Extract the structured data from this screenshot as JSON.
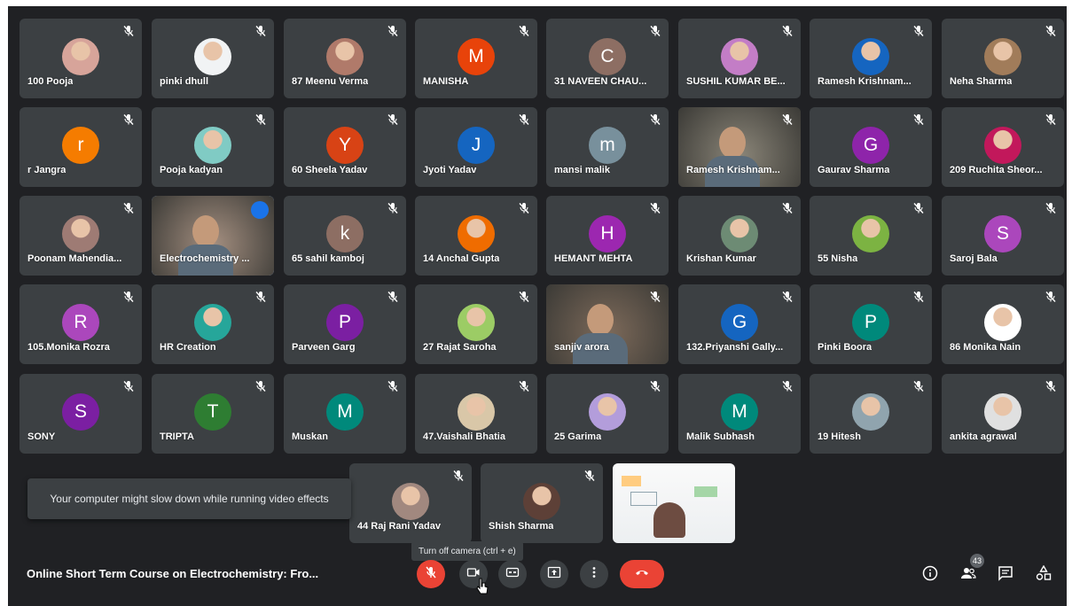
{
  "app": "Google Meet",
  "participants": [
    {
      "name": "100 Pooja",
      "avatar": "photo",
      "color": "#d7a49a"
    },
    {
      "name": "pinki dhull",
      "avatar": "photo",
      "color": "#f1f3f4"
    },
    {
      "name": "87 Meenu Verma",
      "avatar": "photo",
      "color": "#b07a6a"
    },
    {
      "name": "MANISHA",
      "avatar": "letter",
      "letter": "M",
      "color": "#e8430a"
    },
    {
      "name": "31 NAVEEN CHAU...",
      "avatar": "letter",
      "letter": "C",
      "color": "#8d6e63"
    },
    {
      "name": "SUSHIL KUMAR BE...",
      "avatar": "photo",
      "color": "#c37dc6"
    },
    {
      "name": "Ramesh Krishnam...",
      "avatar": "photo",
      "color": "#1565c0"
    },
    {
      "name": "Neha Sharma",
      "avatar": "photo",
      "color": "#a17c5a"
    },
    {
      "name": "r Jangra",
      "avatar": "letter",
      "letter": "r",
      "color": "#f57c00"
    },
    {
      "name": "Pooja kadyan",
      "avatar": "photo",
      "color": "#80cbc4"
    },
    {
      "name": "60 Sheela Yadav",
      "avatar": "letter",
      "letter": "Y",
      "color": "#d84315"
    },
    {
      "name": "Jyoti Yadav",
      "avatar": "letter",
      "letter": "J",
      "color": "#1565c0"
    },
    {
      "name": "mansi malik",
      "avatar": "letter",
      "letter": "m",
      "color": "#78909c"
    },
    {
      "name": "Ramesh Krishnam...",
      "avatar": "video",
      "color": "#8a8578"
    },
    {
      "name": "Gaurav Sharma",
      "avatar": "letter",
      "letter": "G",
      "color": "#8e24aa"
    },
    {
      "name": "209 Ruchita Sheor...",
      "avatar": "photo",
      "color": "#c2185b"
    },
    {
      "name": "Poonam Mahendia...",
      "avatar": "photo",
      "color": "#9e7b74"
    },
    {
      "name": "Electrochemistry ...",
      "avatar": "video",
      "color": "#a48f80"
    },
    {
      "name": "65 sahil kamboj",
      "avatar": "letter",
      "letter": "k",
      "color": "#8d6e63"
    },
    {
      "name": "14 Anchal Gupta",
      "avatar": "photo",
      "color": "#ef6c00"
    },
    {
      "name": "HEMANT MEHTA",
      "avatar": "letter",
      "letter": "H",
      "color": "#9c27b0"
    },
    {
      "name": "Krishan Kumar",
      "avatar": "photo",
      "color": "#6d8b74"
    },
    {
      "name": "55 Nisha",
      "avatar": "photo",
      "color": "#7cb342"
    },
    {
      "name": "Saroj Bala",
      "avatar": "letter",
      "letter": "S",
      "color": "#ab47bc"
    },
    {
      "name": "105.Monika Rozra",
      "avatar": "letter",
      "letter": "R",
      "color": "#ab47bc"
    },
    {
      "name": "HR Creation",
      "avatar": "photo",
      "color": "#26a69a"
    },
    {
      "name": "Parveen Garg",
      "avatar": "letter",
      "letter": "P",
      "color": "#7b1fa2"
    },
    {
      "name": "27 Rajat Saroha",
      "avatar": "photo",
      "color": "#9ccc65"
    },
    {
      "name": "sanjiv arora",
      "avatar": "video",
      "color": "#7d6a5a"
    },
    {
      "name": "132.Priyanshi Gally...",
      "avatar": "letter",
      "letter": "G",
      "color": "#1565c0"
    },
    {
      "name": "Pinki Boora",
      "avatar": "letter",
      "letter": "P",
      "color": "#00897b"
    },
    {
      "name": "86 Monika Nain",
      "avatar": "photo",
      "color": "#ffffff"
    },
    {
      "name": "SONY",
      "avatar": "letter",
      "letter": "S",
      "color": "#7b1fa2"
    },
    {
      "name": "TRIPTA",
      "avatar": "letter",
      "letter": "T",
      "color": "#2e7d32"
    },
    {
      "name": "Muskan",
      "avatar": "letter",
      "letter": "M",
      "color": "#00897b"
    },
    {
      "name": "47.Vaishali Bhatia",
      "avatar": "photo",
      "color": "#d9c7a8"
    },
    {
      "name": "25 Garima",
      "avatar": "photo",
      "color": "#b39ddb"
    },
    {
      "name": "Malik Subhash",
      "avatar": "letter",
      "letter": "M",
      "color": "#00897b"
    },
    {
      "name": "19 Hitesh",
      "avatar": "photo",
      "color": "#90a4ae"
    },
    {
      "name": "ankita agrawal",
      "avatar": "photo",
      "color": "#e0e0e0"
    },
    {
      "name": "44 Raj Rani Yadav",
      "avatar": "photo",
      "color": "#a1887f"
    },
    {
      "name": "Shish Sharma",
      "avatar": "photo",
      "color": "#5d4037"
    },
    {
      "name": "",
      "avatar": "presentation",
      "color": "#f5f5f5"
    }
  ],
  "toast": "Your computer might slow down while running video effects",
  "tooltip": "Turn off camera (ctrl + e)",
  "meeting_title": "Online Short Term Course on Electrochemistry: Fro...",
  "controls": {
    "mic": "mic-off-icon",
    "camera": "camera-icon",
    "captions": "captions-icon",
    "present": "present-icon",
    "more": "more-icon",
    "leave": "leave-call-icon"
  },
  "people_count": "43",
  "colors": {
    "background": "#202124",
    "tile": "#3c4043",
    "danger": "#ea4335",
    "active_border": "#8ab4f8"
  }
}
